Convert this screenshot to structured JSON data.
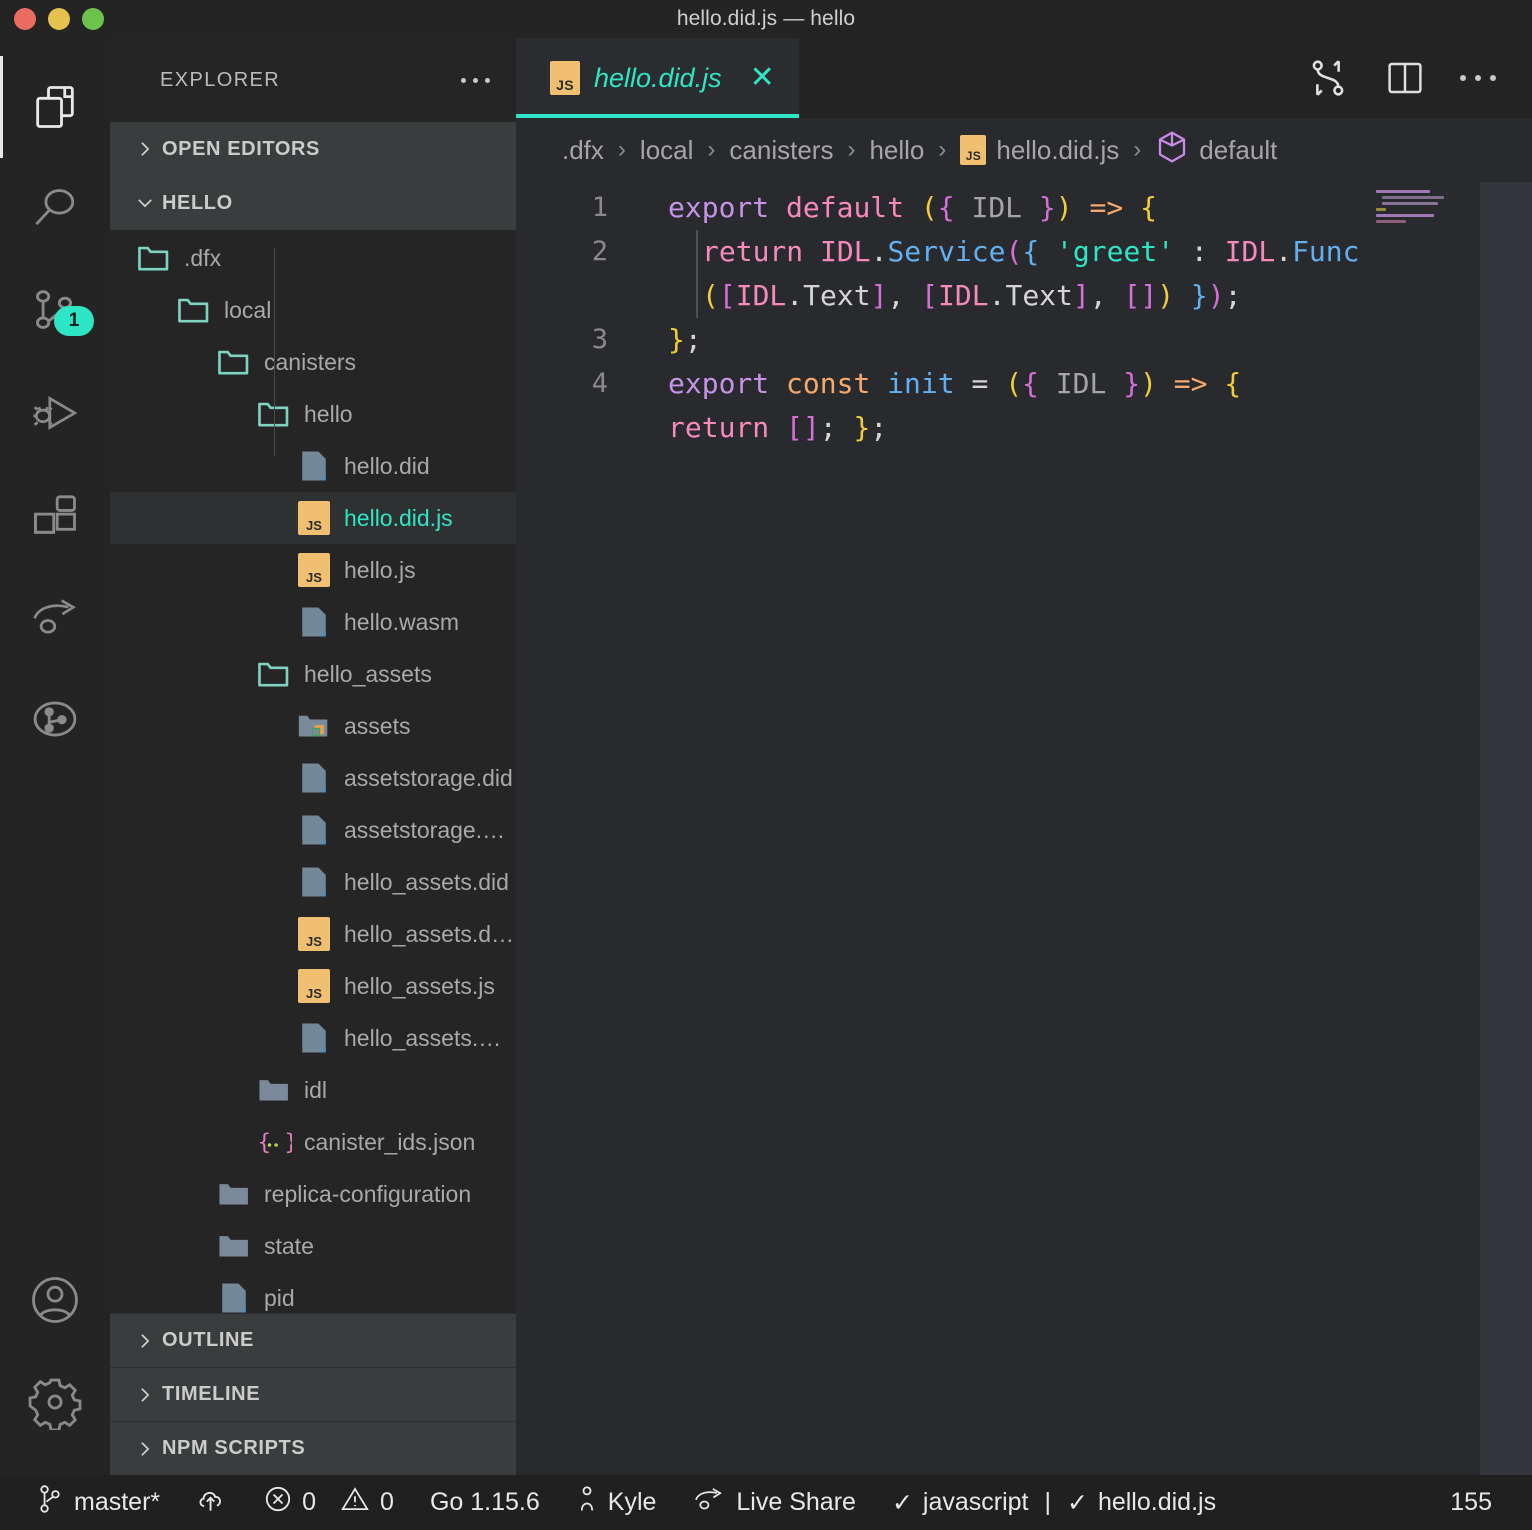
{
  "window": {
    "title": "hello.did.js — hello",
    "traffic_lights": [
      "close",
      "minimize",
      "maximize"
    ]
  },
  "activity_bar": {
    "items": [
      {
        "name": "explorer",
        "icon": "files-icon",
        "active": true,
        "badge": null
      },
      {
        "name": "search",
        "icon": "search-icon",
        "active": false,
        "badge": null
      },
      {
        "name": "source-control",
        "icon": "source-control-icon",
        "active": false,
        "badge": "1"
      },
      {
        "name": "run-and-debug",
        "icon": "run-debug-icon",
        "active": false,
        "badge": null
      },
      {
        "name": "extensions",
        "icon": "extensions-icon",
        "active": false,
        "badge": null
      },
      {
        "name": "live-share",
        "icon": "live-share-icon",
        "active": false,
        "badge": null
      },
      {
        "name": "test-graph",
        "icon": "test-graph-icon",
        "active": false,
        "badge": null
      }
    ],
    "bottom_items": [
      {
        "name": "accounts",
        "icon": "account-icon"
      },
      {
        "name": "manage",
        "icon": "gear-icon"
      }
    ],
    "badge_color": "#2ee6c5"
  },
  "sidebar": {
    "title": "EXPLORER",
    "more_actions": "···",
    "sections": [
      {
        "label": "OPEN EDITORS",
        "expanded": false
      },
      {
        "label": "HELLO",
        "expanded": true
      }
    ],
    "tree": [
      {
        "label": ".dfx",
        "indent": 0,
        "icon": "folder-open-teal",
        "selected": false
      },
      {
        "label": "local",
        "indent": 1,
        "icon": "folder-open-teal",
        "selected": false
      },
      {
        "label": "canisters",
        "indent": 2,
        "icon": "folder-open-teal",
        "selected": false
      },
      {
        "label": "hello",
        "indent": 3,
        "icon": "folder-open-teal",
        "selected": false
      },
      {
        "label": "hello.did",
        "indent": 4,
        "icon": "file-icon",
        "selected": false
      },
      {
        "label": "hello.did.js",
        "indent": 4,
        "icon": "js-icon",
        "selected": true
      },
      {
        "label": "hello.js",
        "indent": 4,
        "icon": "js-icon",
        "selected": false
      },
      {
        "label": "hello.wasm",
        "indent": 4,
        "icon": "file-icon",
        "selected": false
      },
      {
        "label": "hello_assets",
        "indent": 3,
        "icon": "folder-open-teal",
        "selected": false
      },
      {
        "label": "assets",
        "indent": 4,
        "icon": "folder-assets-icon",
        "selected": false
      },
      {
        "label": "assetstorage.did",
        "indent": 4,
        "icon": "file-icon",
        "selected": false
      },
      {
        "label": "assetstorage.w…",
        "indent": 4,
        "icon": "file-icon",
        "selected": false
      },
      {
        "label": "hello_assets.did",
        "indent": 4,
        "icon": "file-icon",
        "selected": false
      },
      {
        "label": "hello_assets.di…",
        "indent": 4,
        "icon": "js-icon",
        "selected": false
      },
      {
        "label": "hello_assets.js",
        "indent": 4,
        "icon": "js-icon",
        "selected": false
      },
      {
        "label": "hello_assets.wa…",
        "indent": 4,
        "icon": "file-icon",
        "selected": false
      },
      {
        "label": "idl",
        "indent": 3,
        "icon": "folder-closed-gray",
        "selected": false
      },
      {
        "label": "canister_ids.json",
        "indent": 3,
        "icon": "json-icon",
        "selected": false
      },
      {
        "label": "replica-configuration",
        "indent": 2,
        "icon": "folder-closed-gray",
        "selected": false
      },
      {
        "label": "state",
        "indent": 2,
        "icon": "folder-closed-gray",
        "selected": false
      },
      {
        "label": "pid",
        "indent": 2,
        "icon": "file-icon",
        "selected": false
      }
    ],
    "bottom_sections": [
      {
        "label": "OUTLINE",
        "expanded": false
      },
      {
        "label": "TIMELINE",
        "expanded": false
      },
      {
        "label": "NPM SCRIPTS",
        "expanded": false
      }
    ]
  },
  "editor": {
    "tab": {
      "label": "hello.did.js",
      "icon": "js-icon",
      "close": "✕",
      "preview_italic": true,
      "accent_color": "#2ee6c5"
    },
    "tab_actions": [
      {
        "name": "split-editor-vertical",
        "icon": "split-editor-icon"
      },
      {
        "name": "open-changes",
        "icon": "compare-changes-icon"
      },
      {
        "name": "more-actions",
        "icon": "ellipsis-icon"
      }
    ],
    "breadcrumb": [
      {
        "label": ".dfx",
        "icon": null
      },
      {
        "label": "local",
        "icon": null
      },
      {
        "label": "canisters",
        "icon": null
      },
      {
        "label": "hello",
        "icon": null
      },
      {
        "label": "hello.did.js",
        "icon": "js-icon"
      },
      {
        "label": "default",
        "icon": "symbol-object-icon"
      }
    ],
    "breadcrumb_separator": "›",
    "line_numbers": [
      "1",
      "2",
      "3",
      "4"
    ],
    "code_lines": [
      "export default ({ IDL }) => {",
      "  return IDL.Service({ 'greet' : IDL.Func",
      "  ([IDL.Text], [IDL.Text], []) });",
      "};",
      "export const init = ({ IDL }) => {",
      "return []; };"
    ],
    "language": "javascript"
  },
  "status_bar": {
    "branch": "master*",
    "sync_icon": "cloud-upload-icon",
    "errors_icon": "error-circle-icon",
    "errors": "0",
    "warnings_icon": "warning-triangle-icon",
    "warnings": "0",
    "go_version": "Go 1.15.6",
    "user_icon": "person-icon",
    "user": "Kyle",
    "live_share_icon": "live-share-icon",
    "live_share": "Live Share",
    "lang_check": "✓",
    "language": "javascript",
    "divider": "|",
    "file_check": "✓",
    "file": "hello.did.js",
    "right_value": "155"
  }
}
